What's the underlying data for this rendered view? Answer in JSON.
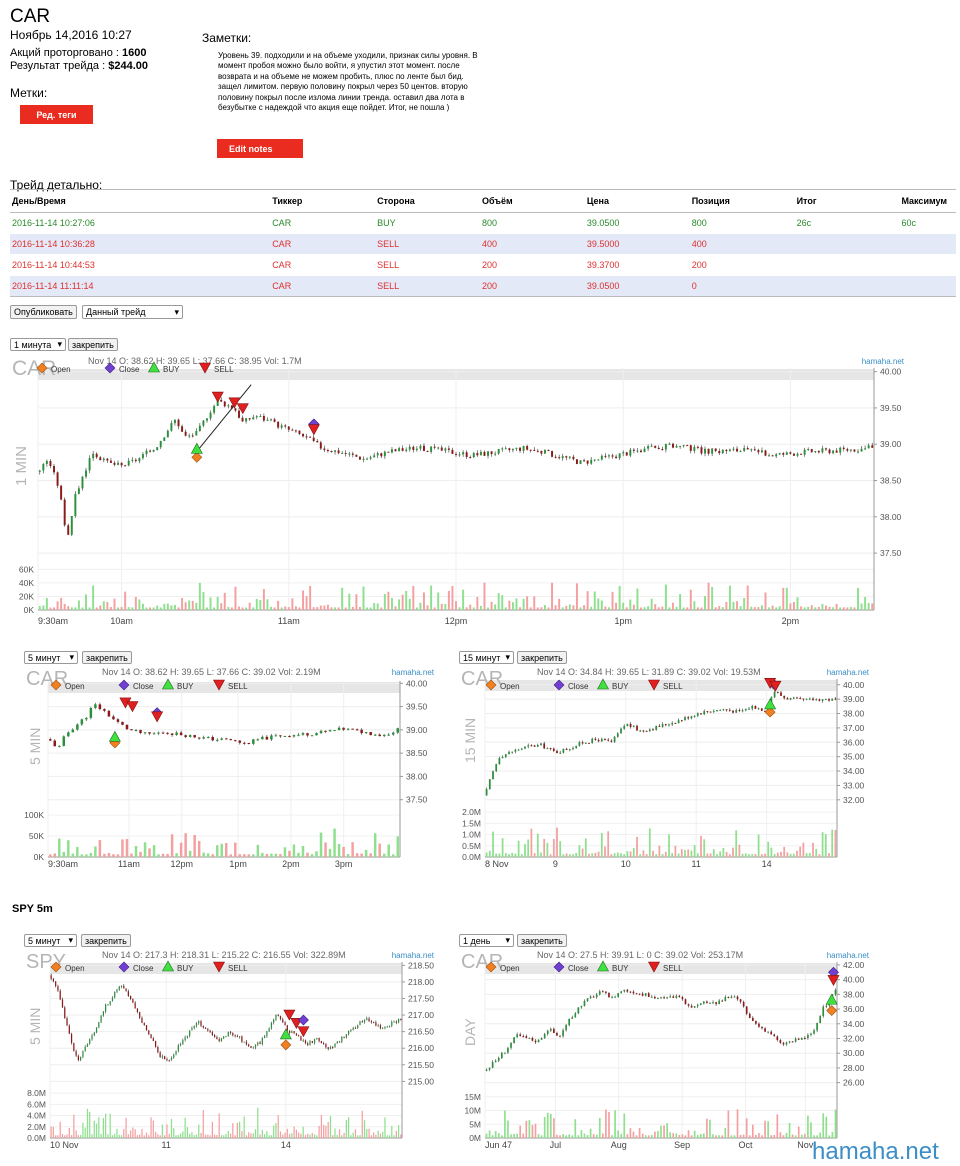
{
  "header": {
    "ticker": "CAR",
    "datetime": "Ноябрь 14,2016 10:27",
    "shares_label": "Акций проторговано :",
    "shares_value": "1600",
    "result_label": "Результат трейда :",
    "result_value": "$244.00",
    "tags_label": "Метки:",
    "tags_button": "Ред. теги"
  },
  "notes": {
    "label": "Заметки:",
    "text": "Уровень 39. подходили и на объеме уходили, признак силы уровня. В момент пробоя можно было войти, я упустил этот момент. после возврата и на объеме не можем пробить, плюс по ленте был бид. защел лимитом. первую половину покрыл через 50 центов. вторую половину покрыл после излома линии тренда. оставил два лота в безубытке с надеждой что акция еще пойдет. Итог, не пошла )",
    "edit_button": "Edit notes"
  },
  "trade": {
    "title": "Трейд детально:",
    "columns": [
      "День/Время",
      "Тиккер",
      "Сторона",
      "Объём",
      "Цена",
      "Позиция",
      "Итог",
      "Максимум"
    ],
    "rows": [
      [
        "2016-11-14 10:27:06",
        "CAR",
        "BUY",
        "800",
        "39.0500",
        "800",
        "26c",
        "60c"
      ],
      [
        "2016-11-14 10:36:28",
        "CAR",
        "SELL",
        "400",
        "39.5000",
        "400",
        "",
        ""
      ],
      [
        "2016-11-14 10:44:53",
        "CAR",
        "SELL",
        "200",
        "39.3700",
        "200",
        "",
        ""
      ],
      [
        "2016-11-14 11:11:14",
        "CAR",
        "SELL",
        "200",
        "39.0500",
        "0",
        "",
        ""
      ]
    ],
    "publish_button": "Опубликовать",
    "scope_select": "Данный трейд"
  },
  "colors": {
    "buy": "#2a8a2a",
    "sell": "#e03030",
    "up": "#2c8f3c",
    "down": "#8a1a1a",
    "vol_up": "#8ee08e",
    "vol_down": "#f4a0a0",
    "accent": "#ea2b1f",
    "row_alt": "#e3e9f6"
  },
  "pin_label": "закрепить",
  "legend": {
    "open": "Open",
    "close": "Close",
    "buy": "BUY",
    "sell": "SELL"
  },
  "watermark": "hamaha.net",
  "spy_label": "SPY 5m",
  "charts": [
    {
      "id": "c1",
      "interval": "1 минута",
      "ticker": "CAR",
      "side": "1 MIN",
      "info": "Nov 14 O: 38.62 H: 39.65 L: 37.66 C: 38.95 Vol: 1.7M",
      "brand": "hamaha.net",
      "price_ticks": [
        "40.00",
        "39.50",
        "39.00",
        "38.50",
        "38.00",
        "37.50"
      ],
      "price_tick_values": [
        40.0,
        39.5,
        39.0,
        38.5,
        38.0,
        37.5
      ],
      "price_range": [
        37.35,
        40.05
      ],
      "vol_ticks": [
        "60K",
        "40K",
        "20K",
        "0K"
      ],
      "vol_tick_values": [
        60000,
        40000,
        20000,
        0
      ],
      "vol_max": 62000,
      "time_labels": [
        "9:30am",
        "10am",
        "11am",
        "12pm",
        "1pm",
        "2pm"
      ],
      "time_label_fracs": [
        0.0,
        0.1,
        0.3,
        0.5,
        0.7,
        0.9
      ],
      "trend_line": {
        "from": [
          0.19,
          38.9
        ],
        "to": [
          0.255,
          39.82
        ]
      },
      "path": [
        [
          0.0,
          38.62
        ],
        [
          0.012,
          38.8
        ],
        [
          0.025,
          38.4
        ],
        [
          0.035,
          37.7
        ],
        [
          0.045,
          38.3
        ],
        [
          0.055,
          38.6
        ],
        [
          0.065,
          38.9
        ],
        [
          0.08,
          38.75
        ],
        [
          0.1,
          38.7
        ],
        [
          0.12,
          38.8
        ],
        [
          0.14,
          38.95
        ],
        [
          0.155,
          39.2
        ],
        [
          0.165,
          39.35
        ],
        [
          0.175,
          39.1
        ],
        [
          0.19,
          39.15
        ],
        [
          0.205,
          39.45
        ],
        [
          0.215,
          39.6
        ],
        [
          0.225,
          39.55
        ],
        [
          0.235,
          39.5
        ],
        [
          0.245,
          39.3
        ],
        [
          0.26,
          39.4
        ],
        [
          0.28,
          39.3
        ],
        [
          0.3,
          39.2
        ],
        [
          0.32,
          39.1
        ],
        [
          0.34,
          38.95
        ],
        [
          0.36,
          38.9
        ],
        [
          0.39,
          38.8
        ],
        [
          0.42,
          38.9
        ],
        [
          0.45,
          38.95
        ],
        [
          0.48,
          38.92
        ],
        [
          0.52,
          38.85
        ],
        [
          0.55,
          38.9
        ],
        [
          0.58,
          38.95
        ],
        [
          0.62,
          38.85
        ],
        [
          0.65,
          38.75
        ],
        [
          0.68,
          38.82
        ],
        [
          0.72,
          38.92
        ],
        [
          0.76,
          38.98
        ],
        [
          0.8,
          38.9
        ],
        [
          0.84,
          38.92
        ],
        [
          0.88,
          38.85
        ],
        [
          0.92,
          38.9
        ],
        [
          0.96,
          38.92
        ],
        [
          1.0,
          38.95
        ]
      ],
      "marks": [
        {
          "kind": "open",
          "x": 0.19,
          "y": 38.82
        },
        {
          "kind": "buy",
          "x": 0.19,
          "y": 38.93
        },
        {
          "kind": "sell",
          "x": 0.215,
          "y": 39.65
        },
        {
          "kind": "sell",
          "x": 0.235,
          "y": 39.57
        },
        {
          "kind": "sell",
          "x": 0.245,
          "y": 39.49
        },
        {
          "kind": "close",
          "x": 0.33,
          "y": 39.28
        },
        {
          "kind": "sell",
          "x": 0.33,
          "y": 39.2
        }
      ]
    },
    {
      "id": "c2",
      "interval": "5 минут",
      "ticker": "CAR",
      "side": "5 MIN",
      "info": "Nov 14 O: 38.62 H: 39.65 L: 37.66 C: 39.02 Vol: 2.19M",
      "brand": "hamaha.net",
      "price_ticks": [
        "40.00",
        "39.50",
        "39.00",
        "38.50",
        "38.00",
        "37.50"
      ],
      "price_tick_values": [
        40.0,
        39.5,
        39.0,
        38.5,
        38.0,
        37.5
      ],
      "price_range": [
        37.3,
        40.05
      ],
      "vol_ticks": [
        "100K",
        "50K",
        "0K"
      ],
      "vol_tick_values": [
        100000,
        50000,
        0
      ],
      "vol_max": 105000,
      "time_labels": [
        "9:30am",
        "11am",
        "12pm",
        "1pm",
        "2pm",
        "3pm"
      ],
      "time_label_fracs": [
        0.0,
        0.23,
        0.38,
        0.54,
        0.69,
        0.84
      ],
      "path": [
        [
          0.0,
          38.8
        ],
        [
          0.03,
          38.6
        ],
        [
          0.05,
          38.9
        ],
        [
          0.08,
          39.1
        ],
        [
          0.11,
          39.3
        ],
        [
          0.13,
          39.55
        ],
        [
          0.16,
          39.4
        ],
        [
          0.19,
          39.2
        ],
        [
          0.23,
          39.0
        ],
        [
          0.28,
          38.9
        ],
        [
          0.33,
          38.95
        ],
        [
          0.38,
          38.9
        ],
        [
          0.42,
          38.85
        ],
        [
          0.47,
          38.8
        ],
        [
          0.52,
          38.78
        ],
        [
          0.56,
          38.7
        ],
        [
          0.6,
          38.8
        ],
        [
          0.66,
          38.88
        ],
        [
          0.72,
          38.9
        ],
        [
          0.78,
          38.95
        ],
        [
          0.84,
          39.02
        ],
        [
          0.9,
          38.95
        ],
        [
          0.95,
          38.88
        ],
        [
          1.0,
          39.02
        ]
      ],
      "marks": [
        {
          "kind": "open",
          "x": 0.19,
          "y": 38.72
        },
        {
          "kind": "buy",
          "x": 0.19,
          "y": 38.84
        },
        {
          "kind": "sell",
          "x": 0.22,
          "y": 39.58
        },
        {
          "kind": "sell",
          "x": 0.24,
          "y": 39.5
        },
        {
          "kind": "close",
          "x": 0.31,
          "y": 39.37
        },
        {
          "kind": "sell",
          "x": 0.31,
          "y": 39.28
        }
      ]
    },
    {
      "id": "c3",
      "interval": "15 минут",
      "ticker": "CAR",
      "side": "15 MIN",
      "info": "Nov 14 O: 34.84 H: 39.65 L: 31.89 C: 39.02 Vol: 19.53M",
      "brand": "hamaha.net",
      "price_ticks": [
        "40.00",
        "39.00",
        "38.00",
        "37.00",
        "36.00",
        "35.00",
        "34.00",
        "33.00",
        "32.00"
      ],
      "price_tick_values": [
        40,
        39,
        38,
        37,
        36,
        35,
        34,
        33,
        32
      ],
      "price_range": [
        31.5,
        40.4
      ],
      "vol_ticks": [
        "2.0M",
        "1.5M",
        "1.0M",
        "0.5M",
        "0.0M"
      ],
      "vol_tick_values": [
        2000000,
        1500000,
        1000000,
        500000,
        0
      ],
      "vol_max": 2050000,
      "time_labels": [
        "8 Nov",
        "9",
        "10",
        "11",
        "14"
      ],
      "time_label_fracs": [
        0.0,
        0.2,
        0.4,
        0.6,
        0.8
      ],
      "path": [
        [
          0.0,
          32.3
        ],
        [
          0.02,
          33.8
        ],
        [
          0.04,
          35.0
        ],
        [
          0.08,
          35.4
        ],
        [
          0.12,
          35.7
        ],
        [
          0.16,
          35.8
        ],
        [
          0.2,
          35.3
        ],
        [
          0.24,
          35.6
        ],
        [
          0.28,
          36.0
        ],
        [
          0.32,
          36.2
        ],
        [
          0.36,
          36.0
        ],
        [
          0.4,
          37.3
        ],
        [
          0.44,
          36.8
        ],
        [
          0.48,
          37.0
        ],
        [
          0.52,
          37.3
        ],
        [
          0.56,
          37.6
        ],
        [
          0.6,
          38.0
        ],
        [
          0.64,
          38.2
        ],
        [
          0.68,
          38.3
        ],
        [
          0.72,
          38.1
        ],
        [
          0.76,
          38.5
        ],
        [
          0.8,
          38.2
        ],
        [
          0.82,
          39.6
        ],
        [
          0.85,
          39.1
        ],
        [
          0.9,
          38.9
        ],
        [
          0.95,
          39.0
        ],
        [
          1.0,
          38.95
        ]
      ],
      "marks": [
        {
          "kind": "open",
          "x": 0.81,
          "y": 38.1
        },
        {
          "kind": "buy",
          "x": 0.81,
          "y": 38.6
        },
        {
          "kind": "close",
          "x": 0.82,
          "y": 40.05
        },
        {
          "kind": "sell",
          "x": 0.81,
          "y": 40.1
        },
        {
          "kind": "sell",
          "x": 0.825,
          "y": 39.9
        }
      ]
    },
    {
      "id": "c4",
      "interval": "5 минут",
      "ticker": "SPY",
      "side": "5 MIN",
      "info": "Nov 14 O: 217.3 H: 218.31 L: 215.22 C: 216.55 Vol: 322.89M",
      "brand": "hamaha.net",
      "price_ticks": [
        "218.50",
        "218.00",
        "217.50",
        "217.00",
        "216.50",
        "216.00",
        "215.50",
        "215.00"
      ],
      "price_tick_values": [
        218.5,
        218.0,
        217.5,
        217.0,
        216.5,
        216.0,
        215.5,
        215.0
      ],
      "price_range": [
        214.8,
        218.6
      ],
      "vol_ticks": [
        "8.0M",
        "6.0M",
        "4.0M",
        "2.0M",
        "0.0M"
      ],
      "vol_tick_values": [
        8000000,
        6000000,
        4000000,
        2000000,
        0
      ],
      "vol_max": 8200000,
      "time_labels": [
        "10 Nov",
        "11",
        "14"
      ],
      "time_label_fracs": [
        0.0,
        0.33,
        0.67
      ],
      "path": [
        [
          0.0,
          218.2
        ],
        [
          0.02,
          217.8
        ],
        [
          0.04,
          217.0
        ],
        [
          0.06,
          216.2
        ],
        [
          0.08,
          215.6
        ],
        [
          0.1,
          216.0
        ],
        [
          0.13,
          216.6
        ],
        [
          0.16,
          217.3
        ],
        [
          0.18,
          217.6
        ],
        [
          0.2,
          217.9
        ],
        [
          0.23,
          217.5
        ],
        [
          0.26,
          216.8
        ],
        [
          0.29,
          216.3
        ],
        [
          0.31,
          215.8
        ],
        [
          0.34,
          215.6
        ],
        [
          0.36,
          216.0
        ],
        [
          0.39,
          216.4
        ],
        [
          0.42,
          216.8
        ],
        [
          0.45,
          216.5
        ],
        [
          0.48,
          216.2
        ],
        [
          0.51,
          216.5
        ],
        [
          0.54,
          216.3
        ],
        [
          0.57,
          216.0
        ],
        [
          0.6,
          216.2
        ],
        [
          0.62,
          216.6
        ],
        [
          0.64,
          217.0
        ],
        [
          0.66,
          216.8
        ],
        [
          0.68,
          216.5
        ],
        [
          0.7,
          216.4
        ],
        [
          0.73,
          216.1
        ],
        [
          0.76,
          216.3
        ],
        [
          0.79,
          216.0
        ],
        [
          0.82,
          216.2
        ],
        [
          0.86,
          216.6
        ],
        [
          0.9,
          216.9
        ],
        [
          0.94,
          216.6
        ],
        [
          1.0,
          216.9
        ]
      ],
      "marks": [
        {
          "kind": "open",
          "x": 0.67,
          "y": 216.1
        },
        {
          "kind": "buy",
          "x": 0.67,
          "y": 216.4
        },
        {
          "kind": "sell",
          "x": 0.68,
          "y": 217.0
        },
        {
          "kind": "sell",
          "x": 0.7,
          "y": 216.75
        },
        {
          "kind": "close",
          "x": 0.72,
          "y": 216.85
        },
        {
          "kind": "sell",
          "x": 0.72,
          "y": 216.5
        }
      ]
    },
    {
      "id": "c5",
      "interval": "1 день",
      "ticker": "CAR",
      "side": "DAY",
      "info": "Nov 14 O: 27.5 H: 39.91 L: 0 C: 39.02 Vol: 253.17M",
      "brand": "hamaha.net",
      "price_ticks": [
        "42.00",
        "40.00",
        "38.00",
        "36.00",
        "34.00",
        "32.00",
        "30.00",
        "28.00",
        "26.00"
      ],
      "price_tick_values": [
        42,
        40,
        38,
        36,
        34,
        32,
        30,
        28,
        26
      ],
      "price_range": [
        25.0,
        42.4
      ],
      "vol_ticks": [
        "15M",
        "10M",
        "5M",
        "0M"
      ],
      "vol_tick_values": [
        15000000,
        10000000,
        5000000,
        0
      ],
      "vol_max": 16000000,
      "time_labels": [
        "Jun 47",
        "Jul",
        "Aug",
        "Sep",
        "Oct",
        "Nov"
      ],
      "time_label_fracs": [
        0.0,
        0.2,
        0.38,
        0.56,
        0.74,
        0.91
      ],
      "path": [
        [
          0.0,
          27.6
        ],
        [
          0.03,
          29.0
        ],
        [
          0.06,
          30.5
        ],
        [
          0.09,
          32.4
        ],
        [
          0.12,
          32.0
        ],
        [
          0.15,
          31.6
        ],
        [
          0.18,
          33.4
        ],
        [
          0.21,
          32.2
        ],
        [
          0.24,
          34.5
        ],
        [
          0.27,
          36.5
        ],
        [
          0.3,
          37.6
        ],
        [
          0.33,
          38.3
        ],
        [
          0.36,
          37.5
        ],
        [
          0.39,
          38.6
        ],
        [
          0.42,
          38.4
        ],
        [
          0.45,
          38.0
        ],
        [
          0.48,
          37.6
        ],
        [
          0.51,
          37.4
        ],
        [
          0.54,
          37.8
        ],
        [
          0.57,
          36.8
        ],
        [
          0.6,
          36.2
        ],
        [
          0.63,
          37.0
        ],
        [
          0.66,
          36.8
        ],
        [
          0.69,
          37.6
        ],
        [
          0.72,
          37.4
        ],
        [
          0.75,
          34.8
        ],
        [
          0.78,
          33.6
        ],
        [
          0.81,
          32.8
        ],
        [
          0.84,
          31.2
        ],
        [
          0.87,
          31.6
        ],
        [
          0.9,
          32.0
        ],
        [
          0.93,
          32.6
        ],
        [
          0.96,
          36.0
        ],
        [
          0.98,
          37.4
        ],
        [
          1.0,
          39.0
        ]
      ],
      "marks": [
        {
          "kind": "open",
          "x": 0.985,
          "y": 35.8
        },
        {
          "kind": "buy",
          "x": 0.985,
          "y": 37.2
        },
        {
          "kind": "close",
          "x": 0.99,
          "y": 41.0
        },
        {
          "kind": "sell",
          "x": 0.99,
          "y": 39.9
        }
      ]
    }
  ]
}
